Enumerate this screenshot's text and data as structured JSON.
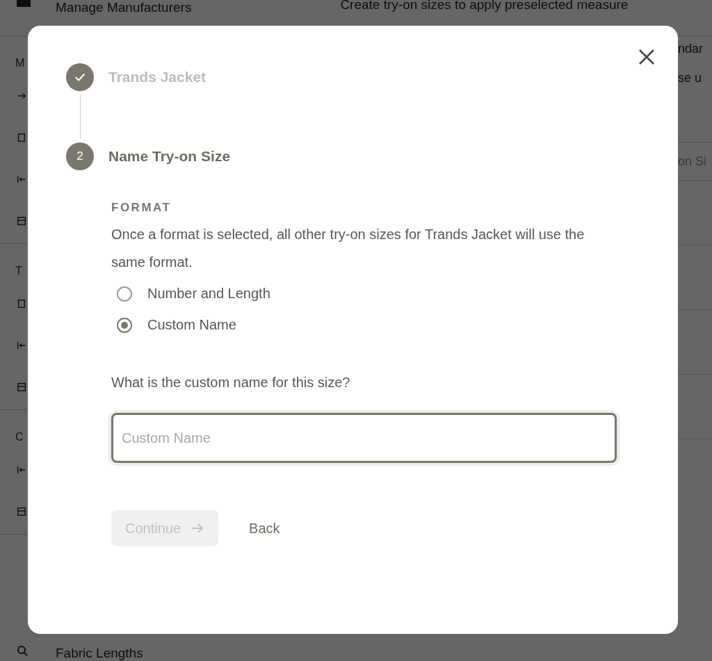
{
  "background": {
    "menu_top": "Manage Manufacturers",
    "intro": "Create try-on sizes to apply preselected measure",
    "intro_line_2": "ndar",
    "intro_line_3": "se u",
    "search_placeholder": "on Si",
    "sidebar_sections": [
      {
        "label": "M"
      },
      {
        "label": "T"
      },
      {
        "label": "C"
      }
    ],
    "menu_bottom": "Fabric Lengths"
  },
  "dialog": {
    "steps": [
      {
        "title": "Trands Jacket",
        "done": true
      },
      {
        "number": "2",
        "title": "Name Try-on Size",
        "done": false
      }
    ],
    "format_heading": "FORMAT",
    "description": "Once a format is selected, all other try-on sizes for Trands Jacket will use the same format.",
    "options": [
      {
        "label": "Number and Length",
        "selected": false
      },
      {
        "label": "Custom Name",
        "selected": true
      }
    ],
    "question": "What is the custom name for this size?",
    "field": {
      "placeholder": "Custom Name"
    },
    "continue_button": {
      "label": "Continue",
      "disabled": true
    },
    "back_button": {
      "label": "Back"
    }
  }
}
